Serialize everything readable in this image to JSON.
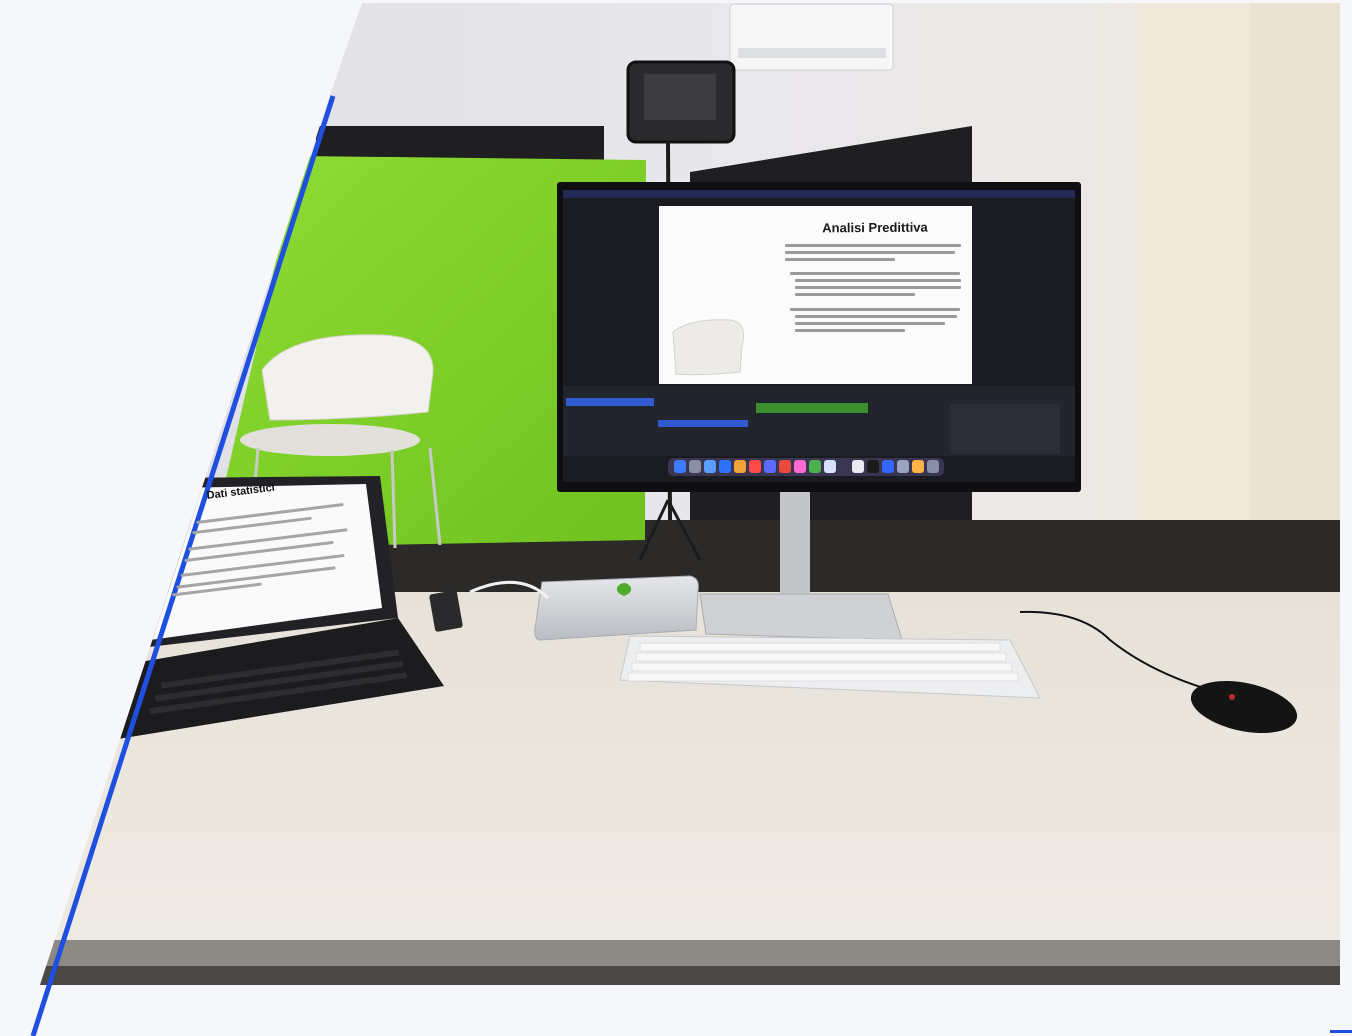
{
  "scene": {
    "monitor_slide_title": "Analisi Predittiva",
    "tablet_slide_title": "Dati statistici"
  },
  "colors": {
    "page_background": "#f6f7fa",
    "accent_line": "#1f4fe0",
    "green_screen": "#7fd12a",
    "desk": "#e9e4db"
  },
  "icons": [
    "apple-logo-icon",
    "dock-icons"
  ]
}
